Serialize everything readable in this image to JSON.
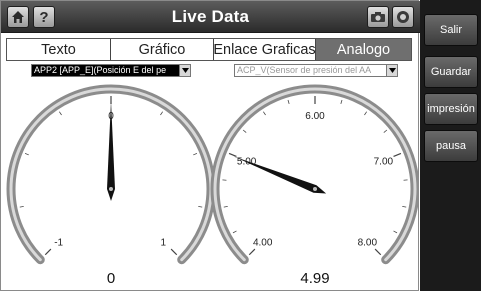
{
  "header": {
    "title": "Live Data",
    "icons": [
      "home-icon",
      "help-icon",
      "camera-icon",
      "record-icon"
    ]
  },
  "tabs": [
    {
      "label": "Texto",
      "active": false
    },
    {
      "label": "Gráfico",
      "active": false
    },
    {
      "label": "Enlace Graficas",
      "active": false
    },
    {
      "label": "Analogo",
      "active": true
    }
  ],
  "selectors": {
    "left": "APP2 [APP_E](Posición E del pe",
    "right": "ACP_V(Sensor de presión del AA"
  },
  "gauges": [
    {
      "ticks": [
        "-1",
        "0",
        "1"
      ],
      "min": -1,
      "max": 1,
      "value": 0,
      "readout": "0"
    },
    {
      "ticks": [
        "4.00",
        "5.00",
        "6.00",
        "7.00",
        "8.00"
      ],
      "min": 4,
      "max": 8,
      "value": 4.99,
      "readout": "4.99"
    }
  ],
  "sidebar": {
    "exit": "Salir",
    "save": "Guardar",
    "print": "impresión",
    "pause": "pausa"
  },
  "colors": {
    "titlebar": "#3a3a3a",
    "active_tab": "#6f6f6f",
    "sidebar": "#1b1b1b",
    "needle": "#111111",
    "gauge_ring": "#8c8c8c"
  }
}
